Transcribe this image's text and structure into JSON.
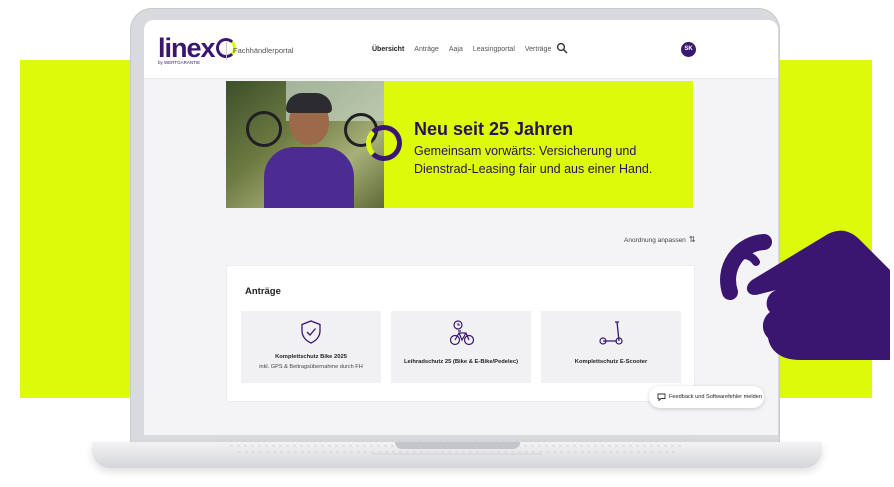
{
  "colors": {
    "accent": "#dcfa0a",
    "brand": "#3a1670"
  },
  "header": {
    "logo": "linex",
    "logo_sub": "by WERTGARANTIE",
    "portal": "Fachhändlerportal",
    "nav": [
      "Übersicht",
      "Anträge",
      "Aaja",
      "Leasingportal",
      "Verträge"
    ],
    "active_nav": "Übersicht",
    "search_icon": "search-icon",
    "avatar": "SK"
  },
  "hero": {
    "title": "Neu seit 25 Jahren",
    "subtitle": "Gemeinsam vorwärts: Versicherung und Dienstrad-Leasing fair und aus einer Hand."
  },
  "arrange": {
    "label": "Anordnung anpassen",
    "icon": "sort-icon"
  },
  "applications": {
    "title": "Anträge",
    "tiles": [
      {
        "icon": "shield-check-icon",
        "title": "Komplettschutz Bike 2025",
        "subtitle": "inkl. GPS & Beitragsübernahme durch FH"
      },
      {
        "icon": "bike-clock-icon",
        "title": "Leihradschutz 25 (Bike & E-Bike/Pedelec)",
        "subtitle": ""
      },
      {
        "icon": "scooter-icon",
        "title": "Komplettschutz E-Scooter",
        "subtitle": ""
      }
    ]
  },
  "feedback": {
    "label": "Feedback und Softwarefehler melden",
    "icon": "feedback-icon"
  },
  "decoration": {
    "hand": "pointing-hand-icon"
  }
}
